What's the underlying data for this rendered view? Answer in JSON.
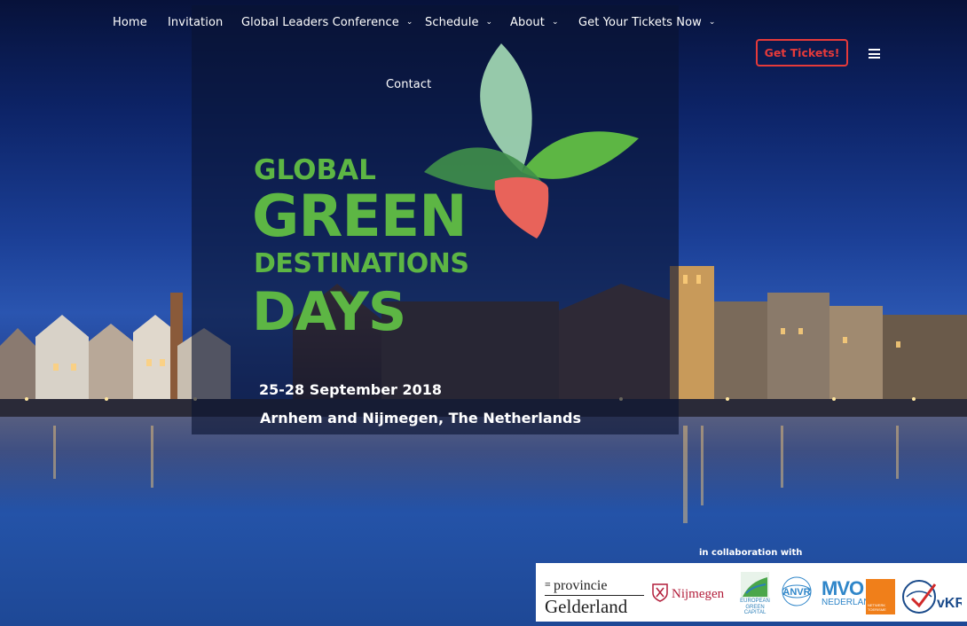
{
  "nav": {
    "items": [
      {
        "label": "Home",
        "has_dropdown": false
      },
      {
        "label": "Invitation",
        "has_dropdown": false
      },
      {
        "label": "Global Leaders Conference",
        "has_dropdown": true
      },
      {
        "label": "Schedule",
        "has_dropdown": true
      },
      {
        "label": "About",
        "has_dropdown": true
      },
      {
        "label": "Get Your Tickets Now",
        "has_dropdown": true
      },
      {
        "label": "Contact",
        "has_dropdown": false
      }
    ],
    "caret_glyph": "⌄",
    "menu_icon": "hamburger-icon"
  },
  "cta": {
    "label": "Get Tickets!",
    "color": "#e63a3a"
  },
  "logo": {
    "line1": "GLOBAL",
    "line2": "GREEN",
    "line3": "DESTINATIONS",
    "line4": "DAYS",
    "color": "#5db644",
    "leaf_colors": [
      "#9ed3b0",
      "#5db644",
      "#3f8f4a",
      "#e8635a"
    ]
  },
  "event": {
    "date": "25-28 September 2018",
    "place": "Arnhem and Nijmegen, The Netherlands"
  },
  "partners": {
    "label": "in collaboration with",
    "items": [
      {
        "name": "provincie Gelderland",
        "line1": "provincie",
        "line2": "Gelderland"
      },
      {
        "name": "Nijmegen",
        "text": "Nijmegen"
      },
      {
        "name": "European Green Capital",
        "text": "EUROPEAN GREEN CAPITAL"
      },
      {
        "name": "ANVR",
        "text": "ANVR"
      },
      {
        "name": "MVO Nederland",
        "line1": "MVO",
        "line2": "NEDERLAND",
        "box_text": "NETWERK TOERISME"
      },
      {
        "name": "vKR",
        "text": "vKR"
      }
    ]
  }
}
